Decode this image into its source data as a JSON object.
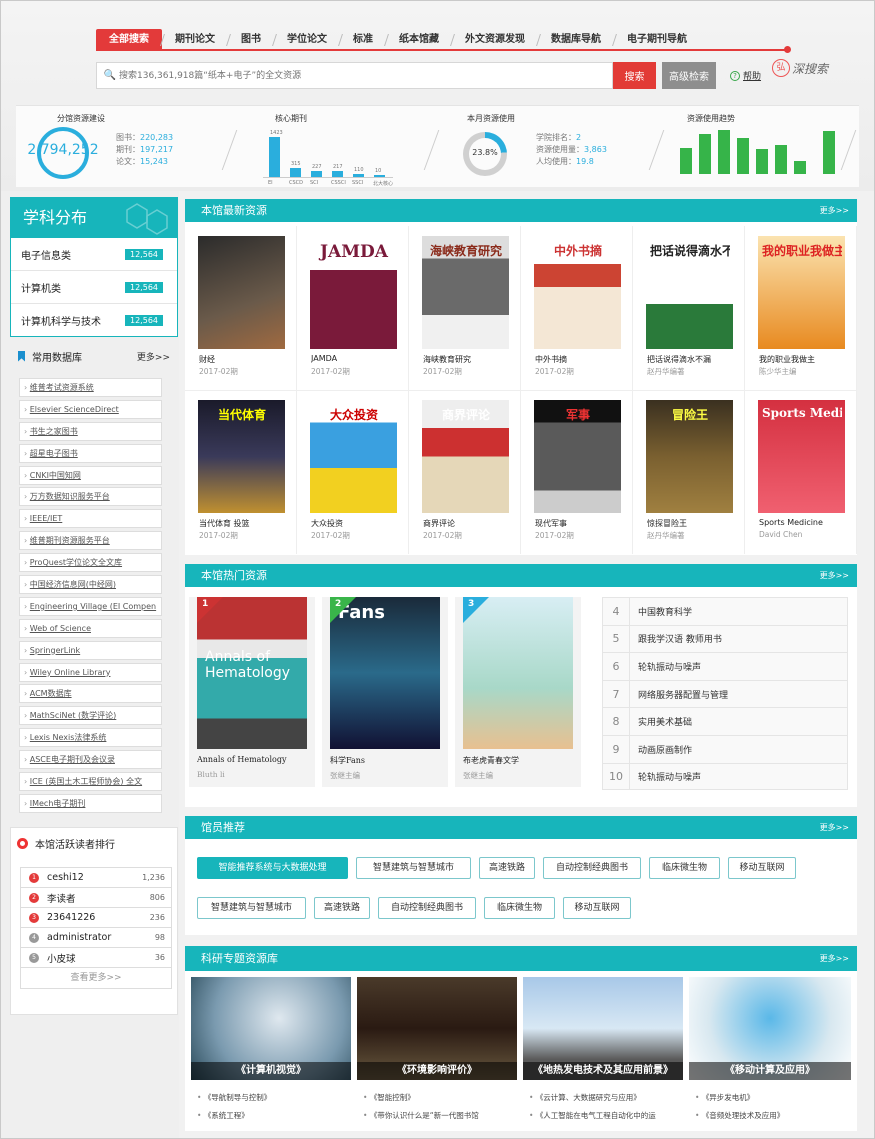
{
  "tabs": [
    "全部搜索",
    "期刊论文",
    "图书",
    "学位论文",
    "标准",
    "纸本馆藏",
    "外文资源发现",
    "数据库导航",
    "电子期刊导航"
  ],
  "search": {
    "placeholder": "搜索136,361,918篇“纸本+电子”的全文资源",
    "search_label": "搜索",
    "advanced_label": "高级检索",
    "help_label": "帮助",
    "deep_label": "深搜索",
    "deep_logo": "弘"
  },
  "stats": {
    "branch": {
      "title": "分馆资源建设",
      "total": "2,794,252",
      "items": [
        {
          "k": "图书：",
          "v": "220,283"
        },
        {
          "k": "期刊：",
          "v": "197,217"
        },
        {
          "k": "论文：",
          "v": "15,243"
        }
      ]
    },
    "core": {
      "title": "核心期刊",
      "values": [
        1423,
        315,
        227,
        217,
        110,
        10
      ],
      "labels": [
        "EI",
        "CSCD",
        "SCI",
        "CSSCI",
        "SSCI",
        "北大核心"
      ],
      "value_labels": [
        "1423",
        "315",
        "227",
        "217",
        "110",
        "10"
      ]
    },
    "month": {
      "title": "本月资源使用",
      "percent": "23.8%",
      "percent_value": 23.8,
      "items": [
        {
          "k": "学院排名：",
          "v": "2"
        },
        {
          "k": "资源使用量：",
          "v": "3,863"
        },
        {
          "k": "人均使用：",
          "v": "19.8"
        }
      ]
    },
    "trend": {
      "title": "资源使用趋势",
      "values": [
        0.58,
        0.9,
        1.0,
        0.82,
        0.56,
        0.65,
        0.3,
        0.98
      ]
    }
  },
  "subject": {
    "title": "学科分布",
    "items": [
      {
        "name": "电子信息类",
        "count": "12,564"
      },
      {
        "name": "计算机类",
        "count": "12,564"
      },
      {
        "name": "计算机科学与技术",
        "count": "12,564"
      }
    ]
  },
  "databases": {
    "title": "常用数据库",
    "more": "更多>>",
    "items": [
      "维普考试资源系统",
      "Elsevier ScienceDirect",
      "书生之家图书",
      "超星电子图书",
      "CNKI中国知网",
      "万方数据知识服务平台",
      "IEEE/IET",
      "维普期刊资源服务平台",
      "ProQuest学位论文全文库",
      "中国经济信息网(中经网)",
      "Engineering Village (EI Compen",
      "Web of Science",
      "SpringerLink",
      "Wiley Online Library",
      "ACM数据库",
      "MathSciNet (数学评论)",
      "Lexis Nexis法律系统",
      "ASCE电子期刊及会议录",
      "ICE (英国土木工程师协会) 全文",
      "IMech电子期刊"
    ]
  },
  "readers": {
    "title": "本馆活跃读者排行",
    "more": "查看更多>>",
    "items": [
      {
        "rank": "1",
        "name": "ceshi12",
        "count": "1,236",
        "color": "#e33a3a"
      },
      {
        "rank": "2",
        "name": "李读者",
        "count": "806",
        "color": "#e33a3a"
      },
      {
        "rank": "3",
        "name": "23641226",
        "count": "236",
        "color": "#e33a3a"
      },
      {
        "rank": "4",
        "name": "administrator",
        "count": "98",
        "color": "#999999"
      },
      {
        "rank": "5",
        "name": "小皮球",
        "count": "36",
        "color": "#999999"
      }
    ]
  },
  "latest": {
    "title": "本馆最新资源",
    "more": "更多>>",
    "books": [
      {
        "title": "财经",
        "sub": "2017-02期"
      },
      {
        "title": "JAMDA",
        "sub": "2017-02期"
      },
      {
        "title": "海峡教育研究",
        "sub": "2017-02期"
      },
      {
        "title": "中外书摘",
        "sub": "2017-02期"
      },
      {
        "title": "把话说得滴水不漏",
        "sub": "赵丹华编著"
      },
      {
        "title": "我的职业我做主",
        "sub": "陈少华主编"
      },
      {
        "title": "当代体育 投篮",
        "sub": "2017-02期"
      },
      {
        "title": "大众投资",
        "sub": "2017-02期"
      },
      {
        "title": "商界评论",
        "sub": "2017-02期"
      },
      {
        "title": "现代军事",
        "sub": "2017-02期"
      },
      {
        "title": "惊探冒险王",
        "sub": "赵丹华编著"
      },
      {
        "title": "Sports Medicine",
        "sub": "David Chen"
      }
    ],
    "cover_text": [
      "",
      "JAMDA",
      "海峡教育研究",
      "中外书摘",
      "把话说得滴水不漏",
      "我的职业我做主",
      "当代体育",
      "大众投资",
      "商界评论",
      "军事",
      "冒险王",
      "Sports Medicine"
    ]
  },
  "hot": {
    "title": "本馆热门资源",
    "more": "更多>>",
    "books": [
      {
        "rank": "1",
        "title": "Annals of Hematology",
        "sub": "Bluth li",
        "cover": "Annals of Hematology"
      },
      {
        "rank": "2",
        "title": "科学Fans",
        "sub": "张继主编",
        "cover": "Fans"
      },
      {
        "rank": "3",
        "title": "布老虎青春文学",
        "sub": "张继主编",
        "cover": ""
      }
    ],
    "ranklist": [
      {
        "rank": "4",
        "title": "中国教育科学"
      },
      {
        "rank": "5",
        "title": "跟我学汉语 教师用书"
      },
      {
        "rank": "6",
        "title": "轮轨振动与噪声"
      },
      {
        "rank": "7",
        "title": "网络服务器配置与管理"
      },
      {
        "rank": "8",
        "title": "实用美术基础"
      },
      {
        "rank": "9",
        "title": "动画原画制作"
      },
      {
        "rank": "10",
        "title": "轮轨振动与噪声"
      }
    ]
  },
  "recommend": {
    "title": "馆员推荐",
    "more": "更多>>",
    "row1": [
      "智能推荐系统与大数据处理",
      "智慧建筑与智慧城市",
      "高速铁路",
      "自动控制经典图书",
      "临床微生物",
      "移动互联网"
    ],
    "row2": [
      "智慧建筑与智慧城市",
      "高速铁路",
      "自动控制经典图书",
      "临床微生物",
      "移动互联网"
    ]
  },
  "topics": {
    "title": "科研专题资源库",
    "more": "更多>>",
    "items": [
      {
        "caption": "《计算机视觉》",
        "links": [
          "《导航制导与控制》",
          "《系统工程》"
        ]
      },
      {
        "caption": "《环境影响评价》",
        "links": [
          "《智能控制》",
          "《带你认识什么是“新一代图书馆"
        ]
      },
      {
        "caption": "《地热发电技术及其应用前景》",
        "links": [
          "《云计算、大数据研究与应用》",
          "《人工智能在电气工程自动化中的运"
        ]
      },
      {
        "caption": "《移动计算及应用》",
        "links": [
          "《异步发电机》",
          "《音频处理技术及应用》"
        ]
      }
    ]
  },
  "colors": {
    "accent": "#e33a3a",
    "teal": "#17b5bb",
    "blue": "#2aaedd",
    "green": "#36b449"
  }
}
